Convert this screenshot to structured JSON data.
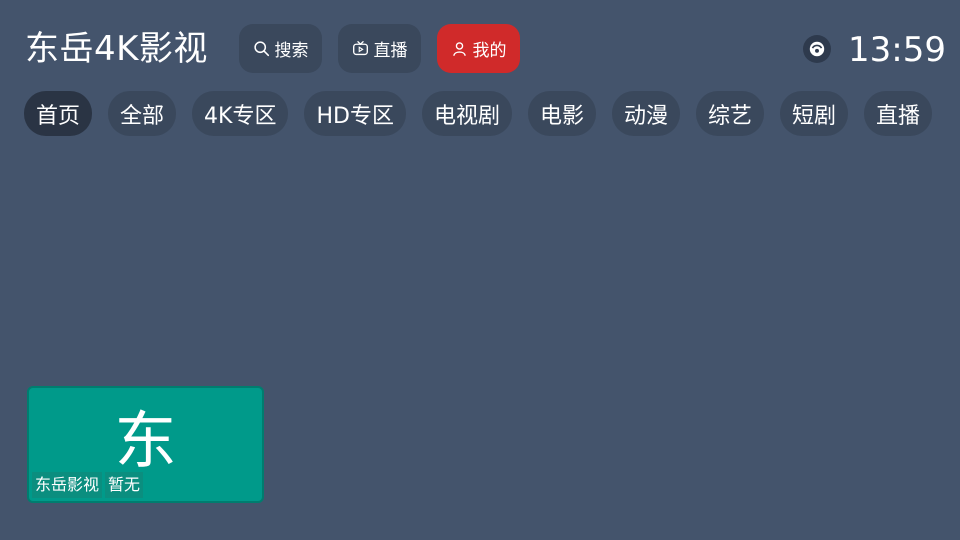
{
  "header": {
    "title": "东岳4K影视",
    "buttons": [
      {
        "label": "搜索",
        "icon": "search-icon"
      },
      {
        "label": "直播",
        "icon": "tv-icon"
      },
      {
        "label": "我的",
        "icon": "user-icon",
        "active": true
      }
    ],
    "network_icon": "network-icon",
    "time": "13:59"
  },
  "nav_tabs": [
    {
      "label": "首页",
      "active": true
    },
    {
      "label": "全部"
    },
    {
      "label": "4K专区"
    },
    {
      "label": "HD专区"
    },
    {
      "label": "电视剧"
    },
    {
      "label": "电影"
    },
    {
      "label": "动漫"
    },
    {
      "label": "综艺"
    },
    {
      "label": "短剧"
    },
    {
      "label": "直播"
    }
  ],
  "cards": [
    {
      "initial": "东",
      "name": "东岳影视",
      "status": "暂无"
    }
  ],
  "colors": {
    "background": "#44546c",
    "button": "#3a485c",
    "active_button": "#d02a2a",
    "card": "#009a8a"
  }
}
